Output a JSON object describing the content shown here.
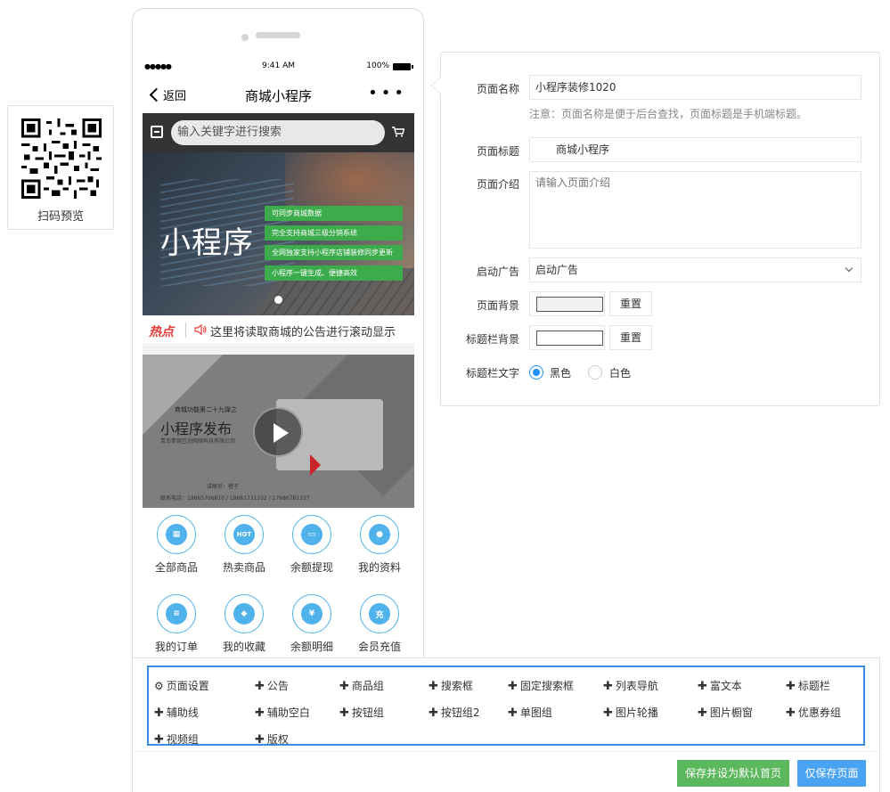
{
  "qr": {
    "label": "扫码预览"
  },
  "phone": {
    "status": {
      "signal": "●●●●●",
      "time": "9:41 AM",
      "battery": "100%"
    },
    "nav": {
      "back": "返回",
      "title": "商城小程序",
      "more": "•••"
    },
    "search": {
      "placeholder": "输入关键字进行搜索"
    },
    "banner": {
      "title": "小程序",
      "pills": [
        "可同步商城数据",
        "完全支持商城三级分销系统",
        "全网独家支持小程序店铺装修同步更新",
        "小程序一键生成、便捷高效"
      ]
    },
    "notice": {
      "hot": "热点",
      "text": "这里将读取商城的公告进行滚动显示"
    },
    "video": {
      "subtitle": "商城功能第二十九弹之",
      "title": "小程序发布",
      "company": "青岛青铜互动网络科技有限公司",
      "lecturer": "讲解员：橙子",
      "contact": "联系电话：18665706810 / 18681731102 / 17686781337"
    },
    "grid": [
      {
        "label": "全部商品",
        "icon": "apps-icon",
        "glyph": "▦"
      },
      {
        "label": "热卖商品",
        "icon": "hot-icon",
        "glyph": "HOT"
      },
      {
        "label": "余额提现",
        "icon": "wallet-icon",
        "glyph": "▭"
      },
      {
        "label": "我的资料",
        "icon": "user-icon",
        "glyph": "●"
      },
      {
        "label": "我的订单",
        "icon": "order-icon",
        "glyph": "≡"
      },
      {
        "label": "我的收藏",
        "icon": "favorite-box-icon",
        "glyph": "◆"
      },
      {
        "label": "余额明细",
        "icon": "money-bag-icon",
        "glyph": "¥"
      },
      {
        "label": "会员充值",
        "icon": "recharge-icon",
        "glyph": "充"
      }
    ]
  },
  "settings": {
    "page_name": {
      "label": "页面名称",
      "value": "小程序装修1020",
      "note": "注意：页面名称是便于后台查找，页面标题是手机端标题。"
    },
    "page_title": {
      "label": "页面标题",
      "value": "商城小程序"
    },
    "page_intro": {
      "label": "页面介绍",
      "placeholder": "请输入页面介绍"
    },
    "launch_ad": {
      "label": "启动广告",
      "value": "启动广告"
    },
    "page_bg": {
      "label": "页面背景",
      "reset": "重置",
      "color": "#f0f0f0"
    },
    "titlebar_bg": {
      "label": "标题栏背景",
      "reset": "重置",
      "color": "#ffffff"
    },
    "titlebar_text": {
      "label": "标题栏文字",
      "options": [
        "黑色",
        "白色"
      ],
      "selected": "黑色"
    }
  },
  "toolbar": {
    "items": [
      {
        "label": "页面设置",
        "icon": "gear-icon"
      },
      {
        "label": "公告",
        "icon": "plus-icon"
      },
      {
        "label": "商品组",
        "icon": "plus-icon"
      },
      {
        "label": "搜索框",
        "icon": "plus-icon"
      },
      {
        "label": "固定搜索框",
        "icon": "plus-icon"
      },
      {
        "label": "列表导航",
        "icon": "plus-icon"
      },
      {
        "label": "富文本",
        "icon": "plus-icon"
      },
      {
        "label": "标题栏",
        "icon": "plus-icon"
      },
      {
        "label": "辅助线",
        "icon": "plus-icon"
      },
      {
        "label": "辅助空白",
        "icon": "plus-icon"
      },
      {
        "label": "按钮组",
        "icon": "plus-icon"
      },
      {
        "label": "按钮组2",
        "icon": "plus-icon"
      },
      {
        "label": "单图组",
        "icon": "plus-icon"
      },
      {
        "label": "图片轮播",
        "icon": "plus-icon"
      },
      {
        "label": "图片橱窗",
        "icon": "plus-icon"
      },
      {
        "label": "优惠券组",
        "icon": "plus-icon"
      },
      {
        "label": "视频组",
        "icon": "plus-icon"
      },
      {
        "label": "版权",
        "icon": "plus-icon"
      }
    ],
    "save_default": "保存并设为默认首页",
    "save_only": "仅保存页面"
  }
}
